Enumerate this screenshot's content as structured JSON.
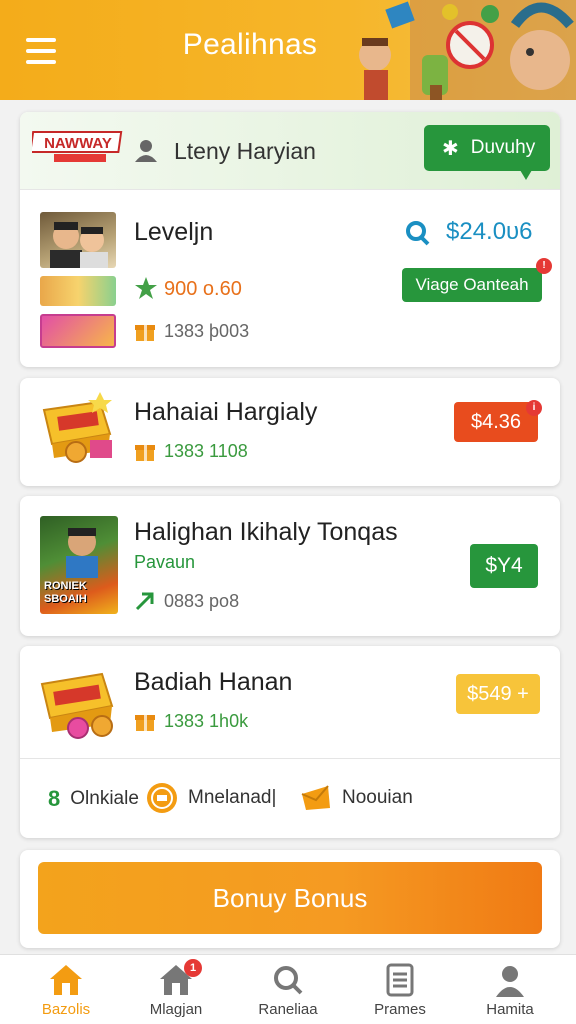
{
  "header": {
    "title": "Pealihnas",
    "menu_icon": "hamburger-menu-icon"
  },
  "card1": {
    "brand": "NAWWAY",
    "user_name": "Lteny Haryian",
    "daily_button": "Duvuhy",
    "item_title": "Leveljn",
    "price": "$24.0υ6",
    "stat_value": "900 o.60",
    "meta": "1383 þ003",
    "action_button": "Viage Oanteah",
    "action_badge": "!"
  },
  "card2": {
    "title": "Hahaiai Hargialy",
    "meta": "1383 1108",
    "price_button": "$4.36",
    "badge": "i"
  },
  "card3": {
    "title": "Halighan Ikihaly Tonqas",
    "thumb_caption": "RONIEK SBOAIH",
    "subtitle": "Pavaun",
    "meta": "0883 po8",
    "price_button": "$Y4"
  },
  "card4": {
    "title": "Badiah Hanan",
    "meta": "1383 1h0k",
    "price_button": "$549 +",
    "footer": [
      {
        "icon": "number-icon",
        "glyph": "8",
        "label": "Olnkiale"
      },
      {
        "icon": "coin-icon",
        "glyph": "",
        "label": "Mnelanad|"
      },
      {
        "icon": "envelope-icon",
        "glyph": "",
        "label": "Noouian"
      }
    ]
  },
  "bonus_button": "Bonuy Bonus",
  "bottom_nav": [
    {
      "label": "Bazolis",
      "icon": "home-icon",
      "active": true
    },
    {
      "label": "Mlagjan",
      "icon": "store-icon",
      "badge": "1"
    },
    {
      "label": "Raneliaa",
      "icon": "search-icon"
    },
    {
      "label": "Prames",
      "icon": "list-icon"
    },
    {
      "label": "Hamita",
      "icon": "profile-icon"
    }
  ],
  "colors": {
    "header": "#f4ac1a",
    "green": "#27963c",
    "red": "#e84c1e",
    "orange": "#f39c12",
    "blue": "#1a8fc2"
  }
}
